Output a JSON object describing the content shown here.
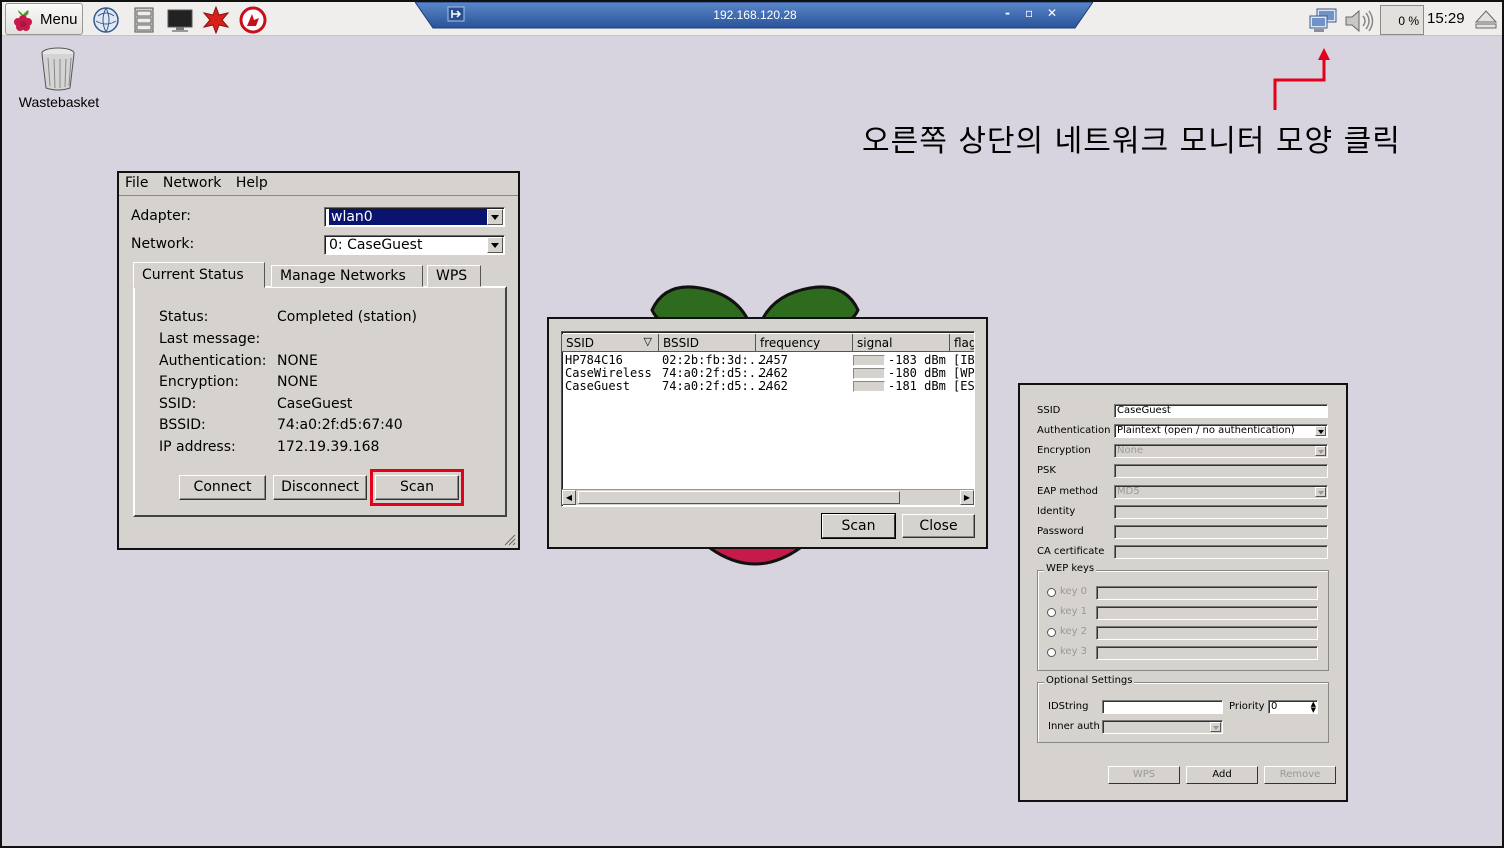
{
  "taskbar": {
    "menu_label": "Menu",
    "launchers": [
      "browser-icon",
      "file-manager-icon",
      "terminal-icon",
      "mathematica-icon",
      "wolfram-icon"
    ],
    "remote_title": "192.168.120.28",
    "remote_controls": [
      "-",
      "▫",
      "✕"
    ],
    "cpu": "0 %",
    "clock": "15:29"
  },
  "desktop": {
    "wastebasket_label": "Wastebasket",
    "annotation": "오른쪽 상단의 네트워크 모니터 모양 클릭"
  },
  "wpa_gui": {
    "menu": [
      "File",
      "Network",
      "Help"
    ],
    "adapter_label": "Adapter:",
    "adapter_value": "wlan0",
    "network_label": "Network:",
    "network_value": "0: CaseGuest",
    "tabs": [
      "Current Status",
      "Manage Networks",
      "WPS"
    ],
    "status_rows": [
      {
        "label": "Status:",
        "value": "Completed (station)"
      },
      {
        "label": "Last message:",
        "value": ""
      },
      {
        "label": "Authentication:",
        "value": "NONE"
      },
      {
        "label": "Encryption:",
        "value": "NONE"
      },
      {
        "label": "SSID:",
        "value": "CaseGuest"
      },
      {
        "label": "BSSID:",
        "value": "74:a0:2f:d5:67:40"
      },
      {
        "label": "IP address:",
        "value": "172.19.39.168"
      }
    ],
    "buttons": {
      "connect": "Connect",
      "disconnect": "Disconnect",
      "scan": "Scan"
    }
  },
  "scan_results": {
    "columns": [
      "SSID",
      "BSSID",
      "frequency",
      "signal",
      "flag"
    ],
    "rows": [
      {
        "ssid": "HP784C16",
        "bssid": "02:2b:fb:3d:...",
        "frequency": "2457",
        "signal": "-183 dBm",
        "flag": "[IBS"
      },
      {
        "ssid": "CaseWireless",
        "bssid": "74:a0:2f:d5:...",
        "frequency": "2462",
        "signal": "-180 dBm",
        "flag": "[WP"
      },
      {
        "ssid": "CaseGuest",
        "bssid": "74:a0:2f:d5:...",
        "frequency": "2462",
        "signal": "-181 dBm",
        "flag": "[ES"
      }
    ],
    "buttons": {
      "scan": "Scan",
      "close": "Close"
    }
  },
  "network_editor": {
    "ssid_label": "SSID",
    "ssid_value": "CaseGuest",
    "auth_label": "Authentication",
    "auth_value": "Plaintext (open / no authentication)",
    "enc_label": "Encryption",
    "enc_value": "None",
    "psk_label": "PSK",
    "eap_label": "EAP method",
    "eap_value": "MD5",
    "identity_label": "Identity",
    "password_label": "Password",
    "ca_label": "CA certificate",
    "wep_group": "WEP keys",
    "wep_keys": [
      "key 0",
      "key 1",
      "key 2",
      "key 3"
    ],
    "optional_group": "Optional Settings",
    "idstring_label": "IDString",
    "priority_label": "Priority",
    "priority_value": "0",
    "inner_auth_label": "Inner auth",
    "buttons": {
      "wps": "WPS",
      "add": "Add",
      "remove": "Remove"
    }
  },
  "colors": {
    "annotation_red": "#e2001a",
    "selection_blue": "#0a146e",
    "desktop": "#d7d3df"
  }
}
